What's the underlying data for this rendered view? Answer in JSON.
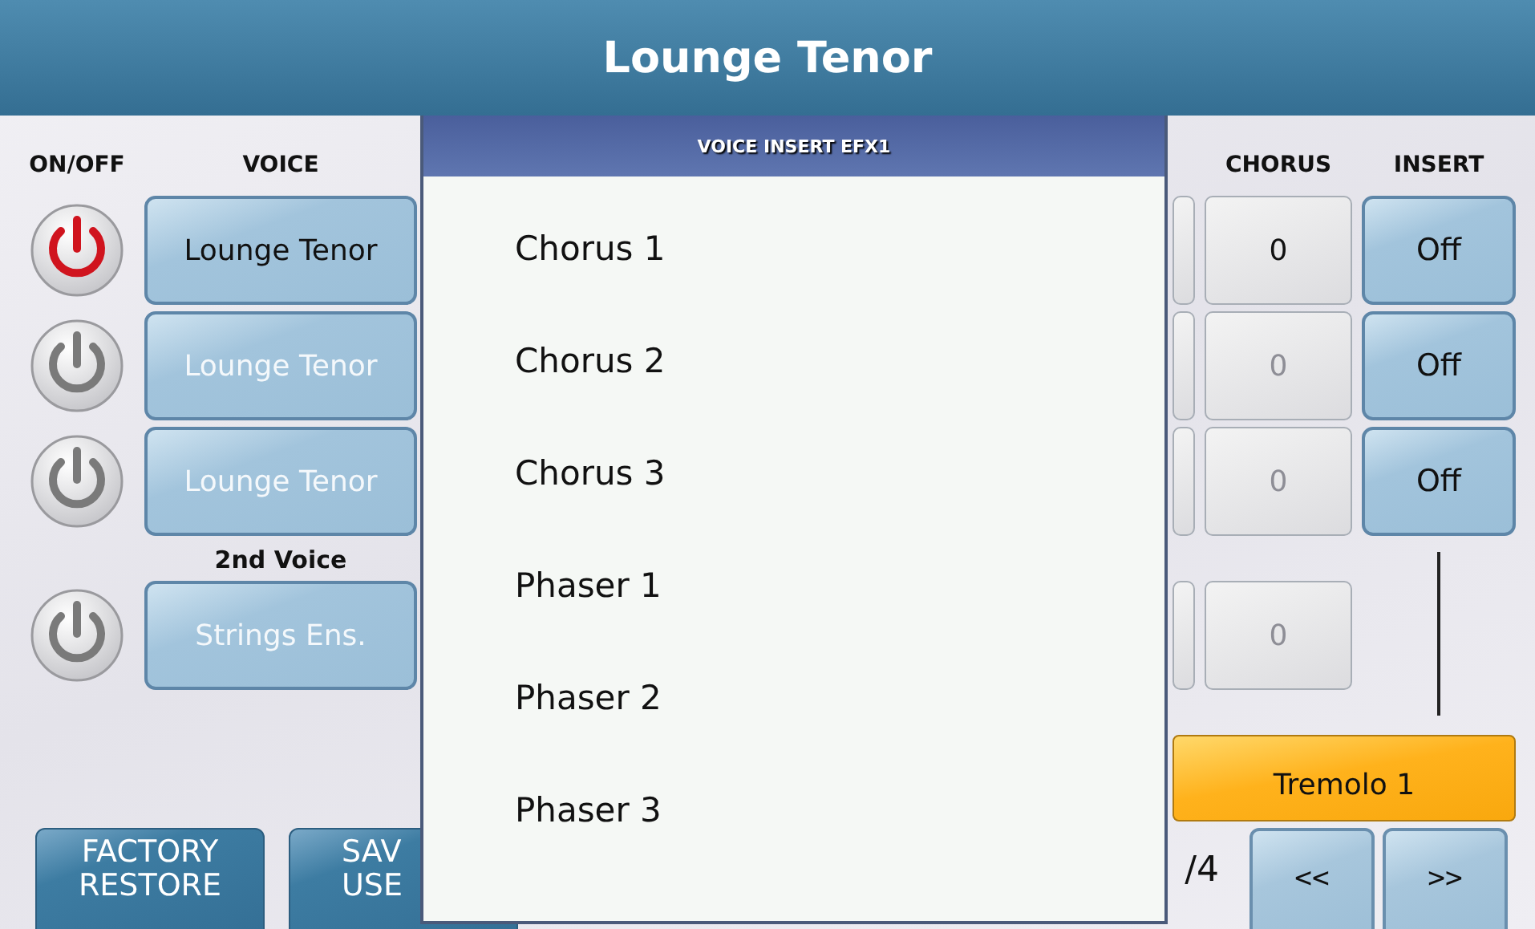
{
  "title": "Lounge Tenor",
  "headers": {
    "on_off": "ON/OFF",
    "voice": "VOICE",
    "chorus": "CHORUS",
    "insert": "INSERT"
  },
  "voices": [
    {
      "on": true,
      "voice": "Lounge Tenor",
      "chorus": "0",
      "insert": "Off"
    },
    {
      "on": false,
      "voice": "Lounge Tenor",
      "chorus": "0",
      "insert": "Off"
    },
    {
      "on": false,
      "voice": "Lounge Tenor",
      "chorus": "0",
      "insert": "Off"
    },
    {
      "label": "2nd Voice",
      "on": false,
      "voice": "Strings Ens.",
      "chorus": "0"
    }
  ],
  "insert_effect": "Tremolo 1",
  "bottom": {
    "factory_restore": [
      "FACTORY",
      "RESTORE"
    ],
    "save_user": [
      "SAV",
      "USE"
    ],
    "page": "/4",
    "prev": "<<",
    "next": ">>"
  },
  "popup": {
    "title": "VOICE INSERT EFX1",
    "items": [
      "Chorus 1",
      "Chorus 2",
      "Chorus 3",
      "Phaser 1",
      "Phaser 2",
      "Phaser 3"
    ]
  }
}
